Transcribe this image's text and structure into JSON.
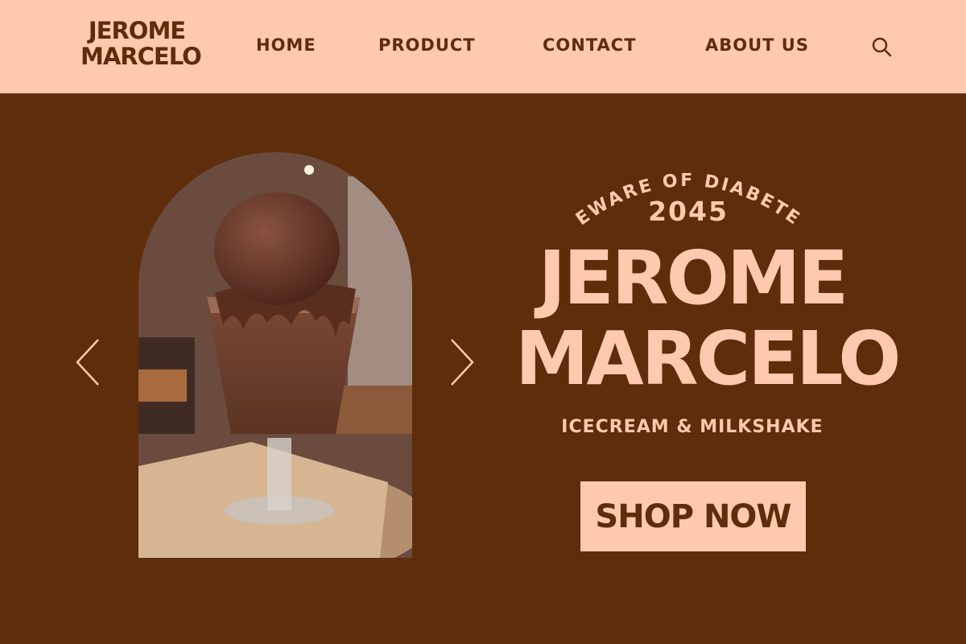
{
  "header": {
    "logo_line1": "JEROME",
    "logo_line2": "MARCELO",
    "nav": [
      "HOME",
      "PRODUCT",
      "CONTACT",
      "ABOUT US"
    ],
    "search_icon": "search-icon"
  },
  "hero": {
    "arc_text": "BEWARE OF DIABETES",
    "year": "2045",
    "title_line1": "JEROME",
    "title_line2": "MARCELO",
    "tagline": "ICECREAM & MILKSHAKE",
    "cta": "SHOP NOW",
    "image_alt": "chocolate ice cream sundae in a glass"
  },
  "colors": {
    "background": "#5e2d0c",
    "accent": "#fec9ae"
  }
}
